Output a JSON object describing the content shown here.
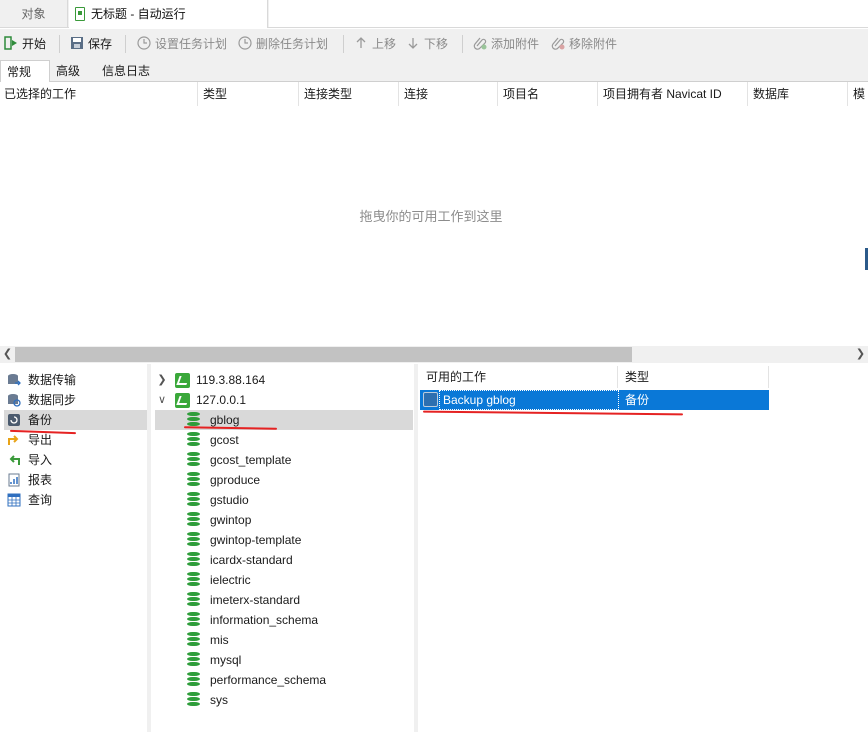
{
  "window_tabs": {
    "objects": "对象",
    "active": "无标题 - 自动运行"
  },
  "toolbar": {
    "start": "开始",
    "save": "保存",
    "set_schedule": "设置任务计划",
    "delete_schedule": "删除任务计划",
    "move_up": "上移",
    "move_down": "下移",
    "add_attachment": "添加附件",
    "remove_attachment": "移除附件"
  },
  "tabs": [
    "常规",
    "高级",
    "信息日志"
  ],
  "job_table": {
    "columns": [
      "已选择的工作",
      "类型",
      "连接类型",
      "连接",
      "项目名",
      "项目拥有者 Navicat ID",
      "数据库",
      "模"
    ],
    "empty_message": "拖曳你的可用工作到这里"
  },
  "categories": [
    {
      "label": "数据传输",
      "icon": "data-transfer-icon"
    },
    {
      "label": "数据同步",
      "icon": "data-sync-icon"
    },
    {
      "label": "备份",
      "icon": "backup-icon"
    },
    {
      "label": "导出",
      "icon": "export-icon"
    },
    {
      "label": "导入",
      "icon": "import-icon"
    },
    {
      "label": "报表",
      "icon": "report-icon"
    },
    {
      "label": "查询",
      "icon": "query-icon"
    }
  ],
  "selected_category": "备份",
  "servers": [
    {
      "name": "119.3.88.164",
      "expanded": false
    },
    {
      "name": "127.0.0.1",
      "expanded": true
    }
  ],
  "databases": [
    "gblog",
    "gcost",
    "gcost_template",
    "gproduce",
    "gstudio",
    "gwintop",
    "gwintop-template",
    "icardx-standard",
    "ielectric",
    "imeterx-standard",
    "information_schema",
    "mis",
    "mysql",
    "performance_schema",
    "sys"
  ],
  "selected_database": "gblog",
  "available_jobs": {
    "columns": [
      "可用的工作",
      "类型"
    ],
    "rows": [
      {
        "name": "Backup gblog",
        "type": "备份"
      }
    ]
  },
  "colors": {
    "selection": "#0a78d7",
    "annotation": "#e52222",
    "db_icon": "#2e9d3a"
  }
}
